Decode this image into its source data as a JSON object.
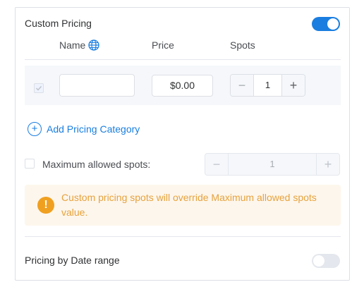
{
  "custom_pricing": {
    "title": "Custom Pricing",
    "enabled": true
  },
  "columns": {
    "name": "Name",
    "price": "Price",
    "spots": "Spots"
  },
  "pricing_row": {
    "name_value": "",
    "price_value": "$0.00",
    "spots_value": "1",
    "minus_symbol": "−",
    "plus_symbol": "+"
  },
  "add_category": {
    "icon": "+",
    "label": "Add Pricing Category"
  },
  "max_spots": {
    "label": "Maximum allowed spots:",
    "value": "1",
    "checked": false
  },
  "alert": {
    "icon_symbol": "!",
    "message": "Custom pricing spots will override Maximum allowed spots value."
  },
  "date_range": {
    "label": "Pricing by Date range",
    "enabled": false
  },
  "colors": {
    "accent": "#1a7ee0",
    "warning": "#e6a23c",
    "warning_bg": "#fdf6ec"
  }
}
